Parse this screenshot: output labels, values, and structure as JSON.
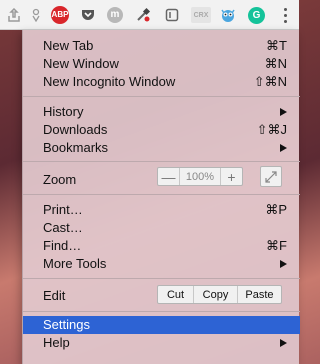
{
  "toolbar": {
    "extensions": [
      {
        "name": "share-icon",
        "color": "#9a9a9a"
      },
      {
        "name": "puzzle-icon",
        "color": "#9a9a9a"
      },
      {
        "name": "adblock-plus-icon",
        "color": "#d9262b",
        "text": "ABP"
      },
      {
        "name": "pocket-icon",
        "color": "#555555"
      },
      {
        "name": "m-icon",
        "color": "#b8b8b8",
        "text": "m"
      },
      {
        "name": "eyedropper-icon",
        "color": "#666666"
      },
      {
        "name": "note-icon",
        "color": "#666666"
      },
      {
        "name": "crx-icon",
        "color": "#aaaaaa",
        "text": "CRX"
      },
      {
        "name": "owl-icon",
        "color": "#4aa6df"
      },
      {
        "name": "grammarly-icon",
        "color": "#15c39a",
        "text": "G"
      }
    ],
    "menu_button_icon": "vertical-dots-icon"
  },
  "menu": {
    "items": {
      "new_tab": {
        "label": "New Tab",
        "accel": "⌘T"
      },
      "new_window": {
        "label": "New Window",
        "accel": "⌘N"
      },
      "new_incognito": {
        "label": "New Incognito Window",
        "accel": "⇧⌘N"
      },
      "history": {
        "label": "History"
      },
      "downloads": {
        "label": "Downloads",
        "accel": "⇧⌘J"
      },
      "bookmarks": {
        "label": "Bookmarks"
      },
      "zoom": {
        "label": "Zoom"
      },
      "print": {
        "label": "Print…",
        "accel": "⌘P"
      },
      "cast": {
        "label": "Cast…"
      },
      "find": {
        "label": "Find…",
        "accel": "⌘F"
      },
      "more_tools": {
        "label": "More Tools"
      },
      "edit": {
        "label": "Edit"
      },
      "settings": {
        "label": "Settings"
      },
      "help": {
        "label": "Help"
      }
    },
    "zoom": {
      "minus": "—",
      "value": "100%",
      "plus": "+"
    },
    "edit": {
      "cut": "Cut",
      "copy": "Copy",
      "paste": "Paste"
    },
    "selected_item": "Settings",
    "selected_color": "#2d63d4"
  }
}
